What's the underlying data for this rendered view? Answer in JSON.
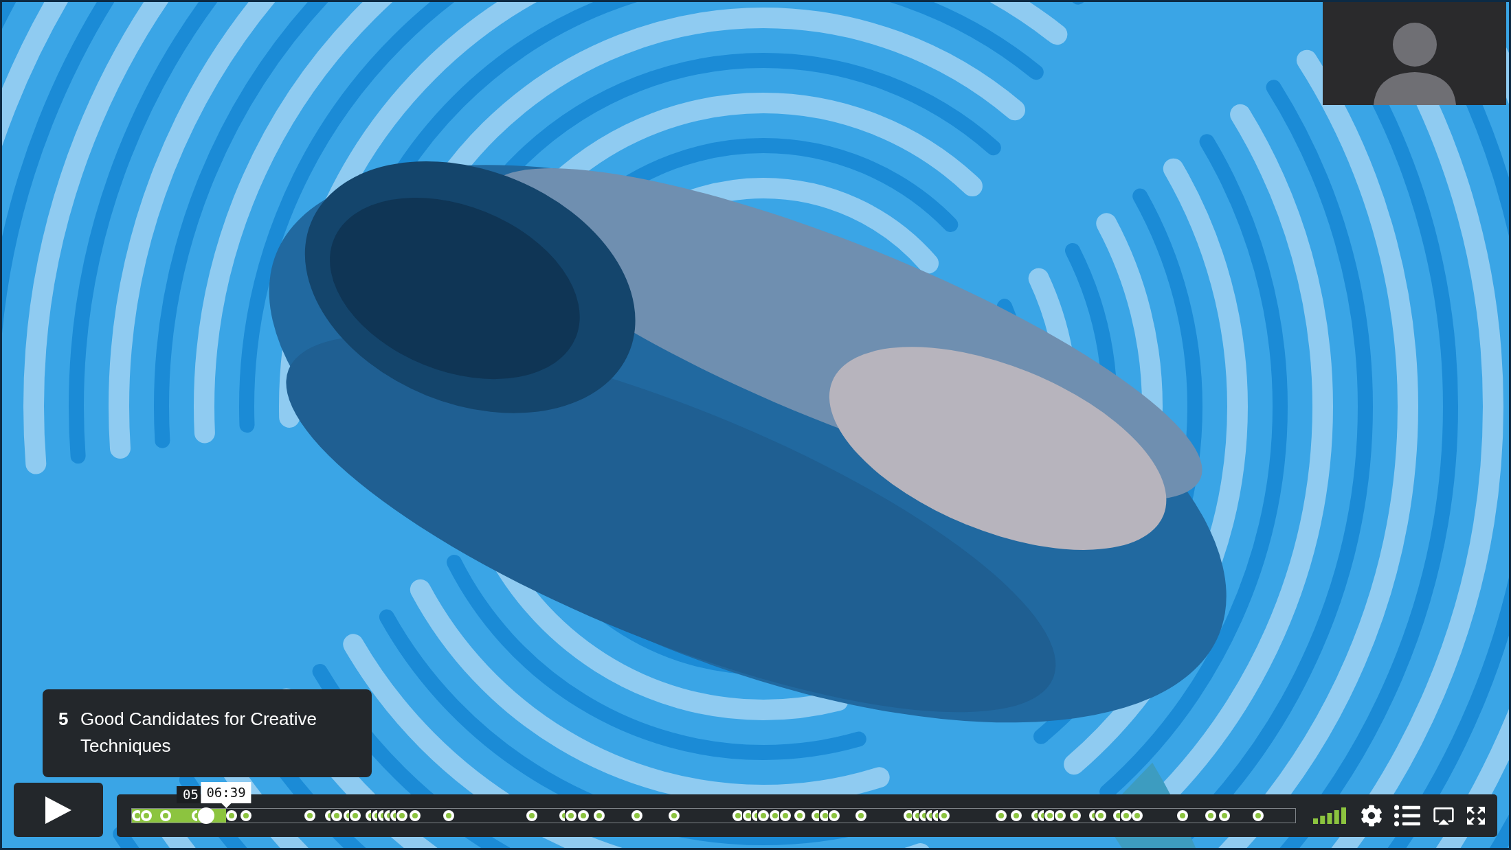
{
  "chapter_card": {
    "number": "5",
    "title": "Good Candidates for Creative Techniques"
  },
  "play_button": {
    "playing": false
  },
  "timeline": {
    "progress": {
      "level": 0.081
    },
    "playhead": {
      "level": 0.064
    },
    "current_time": "05",
    "hover_time": "06:39"
  },
  "volume": {
    "level": 1
  }
}
